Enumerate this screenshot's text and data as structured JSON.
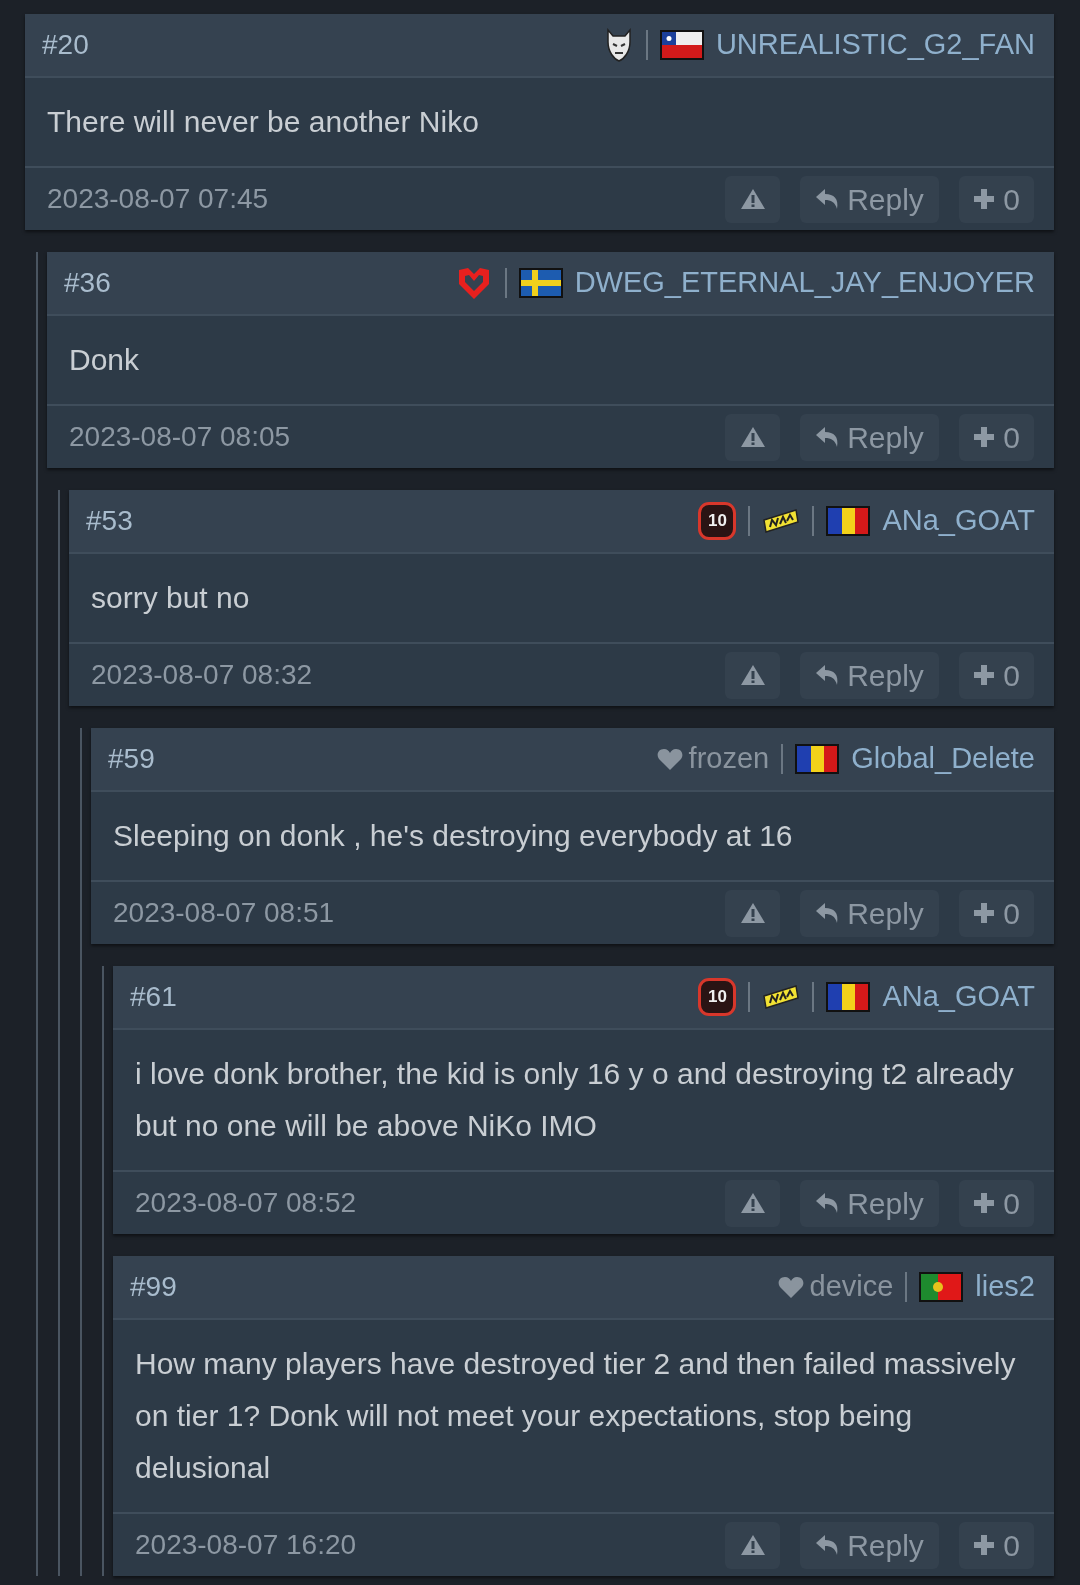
{
  "posts": [
    {
      "number": "#20",
      "badges": [
        {
          "kind": "g2"
        }
      ],
      "flag": {
        "kind": "cl"
      },
      "username": "UNREALISTIC_G2_FAN",
      "text": "There will never be another Niko",
      "time": "2023-08-07 07:45",
      "reply": "Reply",
      "votes": "0",
      "children": [
        {
          "number": "#36",
          "badges": [
            {
              "kind": "mouz"
            }
          ],
          "flag": {
            "kind": "se"
          },
          "username": "DWEG_ETERNAL_JAY_ENJOYER",
          "text": "Donk",
          "time": "2023-08-07 08:05",
          "reply": "Reply",
          "votes": "0",
          "children": [
            {
              "number": "#53",
              "badges": [
                {
                  "kind": "level",
                  "text": "10"
                },
                {
                  "kind": "navi"
                }
              ],
              "flag": {
                "kind": "ro"
              },
              "username": "ANa_GOAT",
              "text": "sorry but no",
              "time": "2023-08-07 08:32",
              "reply": "Reply",
              "votes": "0",
              "children": [
                {
                  "number": "#59",
                  "badges": [
                    {
                      "kind": "fan",
                      "text": "frozen"
                    }
                  ],
                  "flag": {
                    "kind": "ro"
                  },
                  "username": "Global_Delete",
                  "text": "Sleeping on donk , he's destroying everybody at 16",
                  "time": "2023-08-07 08:51",
                  "reply": "Reply",
                  "votes": "0",
                  "children": [
                    {
                      "number": "#61",
                      "badges": [
                        {
                          "kind": "level",
                          "text": "10"
                        },
                        {
                          "kind": "navi"
                        }
                      ],
                      "flag": {
                        "kind": "ro"
                      },
                      "username": "ANa_GOAT",
                      "text": "i love donk brother, the kid is only 16 y o and destroying t2 already but no one will be above NiKo IMO",
                      "time": "2023-08-07 08:52",
                      "reply": "Reply",
                      "votes": "0"
                    },
                    {
                      "number": "#99",
                      "badges": [
                        {
                          "kind": "fan",
                          "text": "device"
                        }
                      ],
                      "flag": {
                        "kind": "pt"
                      },
                      "username": "lies2",
                      "text": "How many players have destroyed tier 2 and then failed massively on tier 1? Donk will not meet your expectations, stop being delusional",
                      "time": "2023-08-07 16:20",
                      "reply": "Reply",
                      "votes": "0"
                    }
                  ]
                }
              ]
            }
          ]
        }
      ]
    }
  ]
}
